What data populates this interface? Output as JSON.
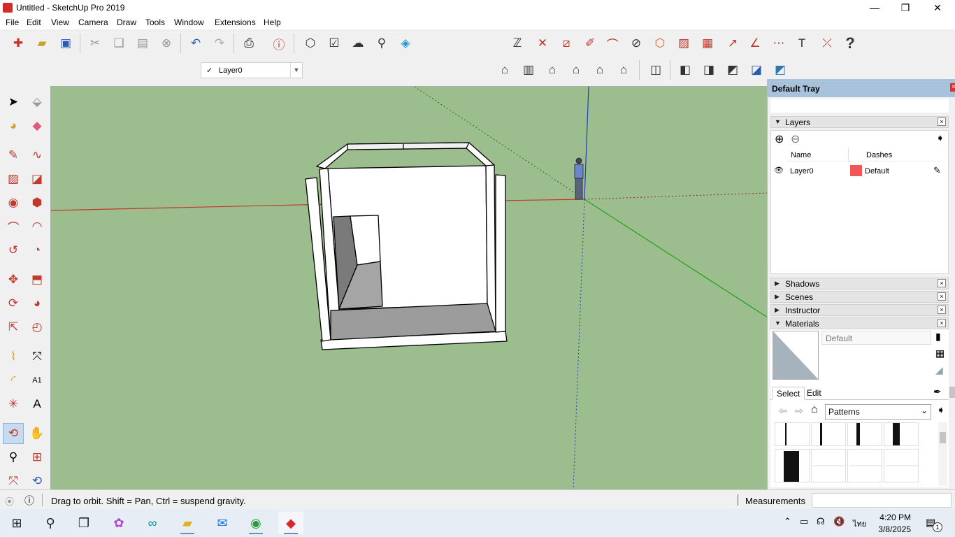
{
  "window": {
    "title": "Untitled - SketchUp Pro 2019",
    "minimize": "—",
    "restore": "❐",
    "close": "✕"
  },
  "menu": [
    "File",
    "Edit",
    "View",
    "Camera",
    "Draw",
    "Tools",
    "Window",
    "Extensions",
    "Help"
  ],
  "layer_toolbar": {
    "check": "✓",
    "current_layer": "Layer0",
    "dropdown": "▼"
  },
  "tray": {
    "title": "Default Tray",
    "close": "×",
    "layers": {
      "title": "Layers",
      "tri": "▼",
      "close": "×",
      "add": "⊕",
      "remove": "⊖",
      "details": "➧",
      "col_name": "Name",
      "col_dashes": "Dashes",
      "rows": [
        {
          "name": "Layer0",
          "color": "#f25757",
          "dashes": "Default",
          "visible_icon": "👁",
          "edit_icon": "✎"
        }
      ]
    },
    "collapsed_panels": [
      {
        "title": "Shadows",
        "tri": "▶",
        "close": "×"
      },
      {
        "title": "Scenes",
        "tri": "▶",
        "close": "×"
      },
      {
        "title": "Instructor",
        "tri": "▶",
        "close": "×"
      }
    ],
    "materials": {
      "title": "Materials",
      "tri": "▼",
      "close": "×",
      "current_name": "Default",
      "tab_select": "Select",
      "tab_edit": "Edit",
      "back": "⇦",
      "forward": "⇨",
      "home": "⌂",
      "library": "Patterns",
      "library_drop": "⌄",
      "details": "➧"
    }
  },
  "status": {
    "hint": "Drag to orbit. Shift = Pan, Ctrl = suspend gravity.",
    "measurements_label": "Measurements",
    "measurements_value": ""
  },
  "taskbar": {
    "time": "4:20 PM",
    "date": "3/8/2025",
    "lang": "ไทย",
    "notification_count": "1"
  },
  "colors": {
    "viewport_ground": "#9cbd8d",
    "axis_red": "#c0392b",
    "axis_green": "#1fa31f",
    "axis_blue": "#1f3fbf",
    "tray_header": "#a9c2dc"
  }
}
